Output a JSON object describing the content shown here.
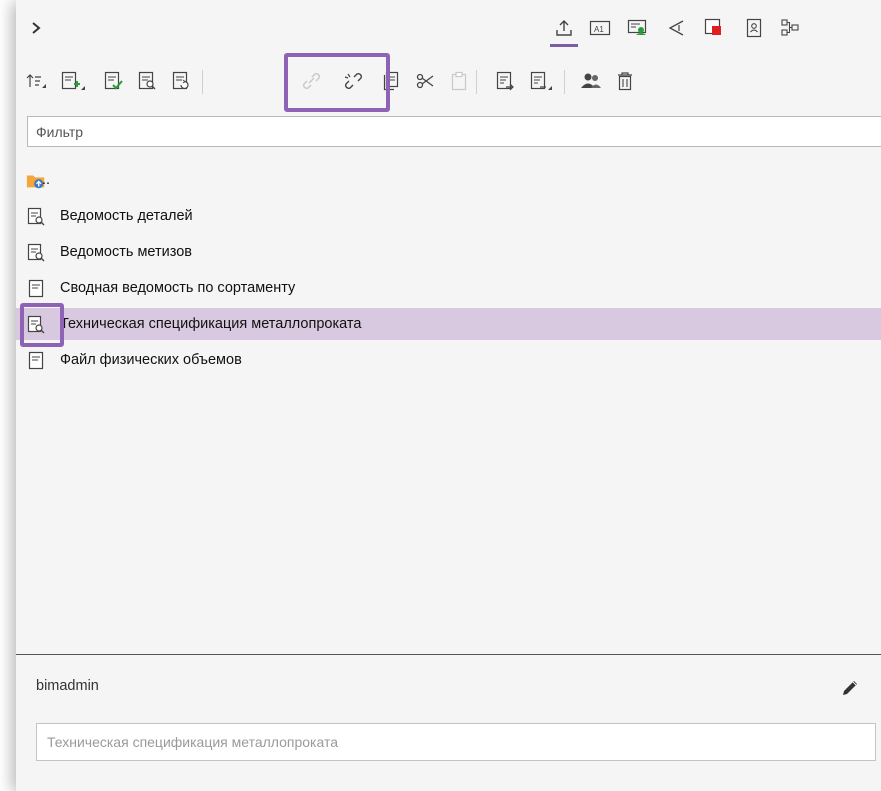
{
  "topbar": {
    "expand_icon": "chevron-right-icon",
    "tabs": [
      {
        "icon": "upload-icon",
        "active": true
      },
      {
        "icon": "text-field-icon",
        "label": "A1"
      },
      {
        "icon": "user-comment-icon"
      },
      {
        "icon": "megaphone-icon"
      },
      {
        "icon": "red-square-icon"
      },
      {
        "icon": "document-contact-icon"
      },
      {
        "icon": "hierarchy-icon"
      }
    ]
  },
  "toolbar": {
    "buttons": [
      "sort-icon",
      "add-document-icon",
      "document-check-icon",
      "document-preview-icon",
      "document-refresh-icon",
      "link-icon",
      "unlink-icon",
      "copy-icon",
      "cut-icon",
      "paste-icon",
      "export-icon",
      "export-menu-icon",
      "users-icon",
      "delete-icon"
    ]
  },
  "filter": {
    "placeholder": "Фильтр",
    "value": ""
  },
  "list": {
    "parent_label": "..",
    "items": [
      {
        "label": "Ведомость деталей",
        "icon": "report-preview-icon"
      },
      {
        "label": "Ведомость метизов",
        "icon": "report-preview-icon"
      },
      {
        "label": "Сводная ведомость по сортаменту",
        "icon": "document-icon"
      },
      {
        "label": "Техническая спецификация металлопроката",
        "icon": "report-preview-icon",
        "selected": true
      },
      {
        "label": "Файл физических объемов",
        "icon": "document-icon"
      }
    ]
  },
  "bottom": {
    "user": "bimadmin",
    "description_placeholder": "Техническая спецификация металлопроката",
    "description_value": ""
  },
  "colors": {
    "accent": "#8e63b6",
    "selection": "#d9c9e0",
    "red": "#e02020",
    "folder": "#f4a63a"
  }
}
